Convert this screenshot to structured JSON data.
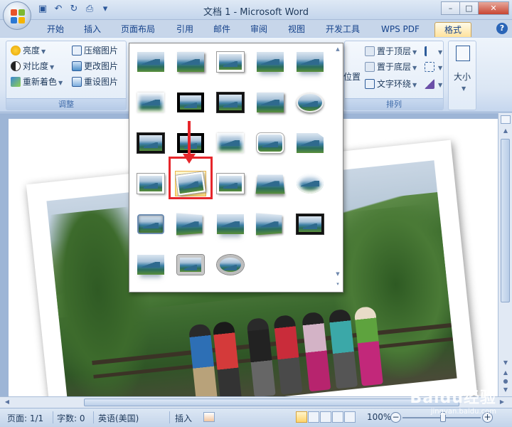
{
  "window": {
    "title": "文档 1 - Microsoft Word",
    "controls": {
      "minimize": "–",
      "maximize": "□",
      "close": "✕"
    }
  },
  "tabs": [
    {
      "label": "开始"
    },
    {
      "label": "插入"
    },
    {
      "label": "页面布局"
    },
    {
      "label": "引用"
    },
    {
      "label": "邮件"
    },
    {
      "label": "审阅"
    },
    {
      "label": "视图"
    },
    {
      "label": "开发工具"
    },
    {
      "label": "WPS PDF"
    },
    {
      "label": "格式",
      "active": true
    }
  ],
  "help_label": "?",
  "ribbon": {
    "adjust": {
      "label": "调整",
      "brightness": "亮度",
      "contrast": "对比度",
      "recolor": "重新着色",
      "compress": "压缩图片",
      "change": "更改图片",
      "reset": "重设图片"
    },
    "arrange": {
      "label": "排列",
      "position": "位置",
      "bring_front": "置于顶层",
      "send_back": "置于底层",
      "text_wrap": "文字环绕"
    },
    "size": {
      "label": "大小"
    }
  },
  "gallery": {
    "rows": [
      [
        "t-plain",
        "t-shadow",
        "t-white",
        "t-reflect",
        "t-reflect"
      ],
      [
        "t-soft",
        "t-thickblack",
        "t-black",
        "t-shadow",
        "t-oval"
      ],
      [
        "t-black",
        "t-thickblack",
        "t-soft",
        "t-round",
        "t-dogear"
      ],
      [
        "t-white",
        "t-tilt-l",
        "t-white",
        "t-persp2",
        "t-ellipse-soft"
      ],
      [
        "t-bevel",
        "t-persp",
        "t-reflect",
        "t-persp",
        "t-black"
      ],
      [
        "t-reflect",
        "t-greyframe",
        "t-ovalframe"
      ]
    ],
    "selected": {
      "row": 3,
      "col": 1
    }
  },
  "statusbar": {
    "page": "页面: 1/1",
    "words": "字数: 0",
    "language": "英语(美国)",
    "insert_mode": "插入",
    "zoom": "100%"
  },
  "watermark": {
    "brand": "Baidu经验",
    "url": "jingyan.baidu.com"
  },
  "colors": {
    "accent": "#15428b",
    "highlight": "#e6262b",
    "active_tab": "#ffe29c"
  }
}
